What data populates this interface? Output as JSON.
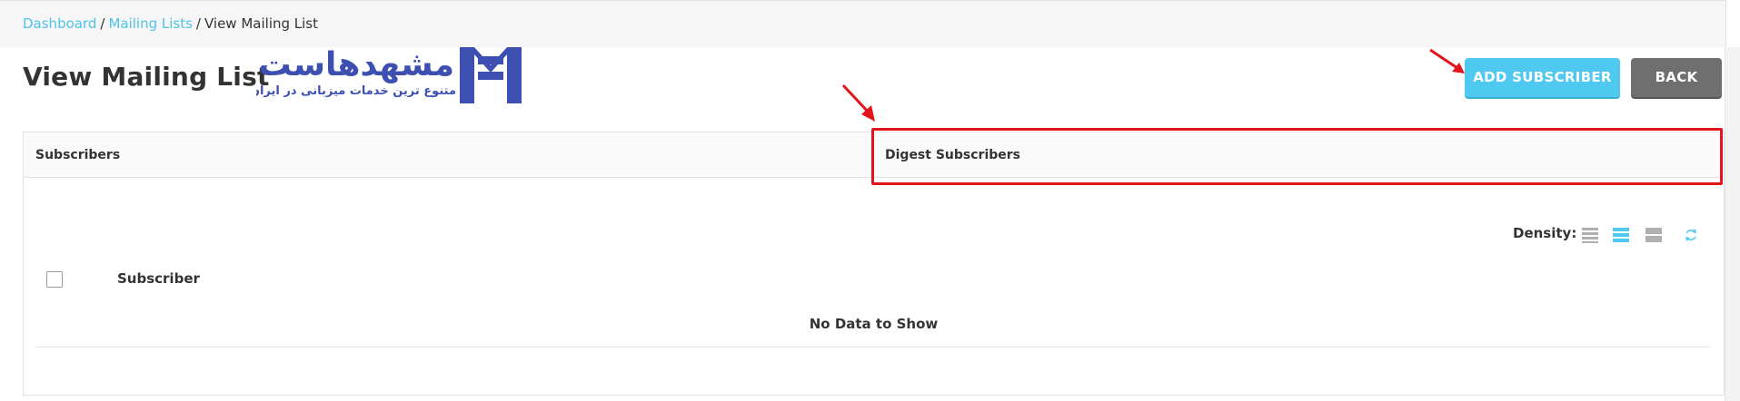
{
  "breadcrumb": {
    "items": [
      "Dashboard",
      "Mailing Lists",
      "View Mailing List"
    ],
    "separator": "/"
  },
  "page": {
    "title": "View Mailing List"
  },
  "logo": {
    "name": "مشهدهاست",
    "tagline": "متنوع ترین خدمات میزبانی در ایران",
    "color": "#3d4fb0"
  },
  "actions": {
    "add_subscriber": "ADD SUBSCRIBER",
    "back": "BACK"
  },
  "tabs": [
    {
      "label": "Subscribers"
    },
    {
      "label": "Digest Subscribers",
      "highlighted": true
    }
  ],
  "table": {
    "density_label": "Density:",
    "density_options": [
      "compact",
      "default",
      "comfortable"
    ],
    "density_selected": "default",
    "columns": [
      "Subscriber"
    ],
    "empty_message": "No Data to Show"
  },
  "colors": {
    "accent": "#4fc9f0",
    "link": "#4fc3e6",
    "back_button": "#6f6f6f",
    "annotation": "#e3141b"
  }
}
